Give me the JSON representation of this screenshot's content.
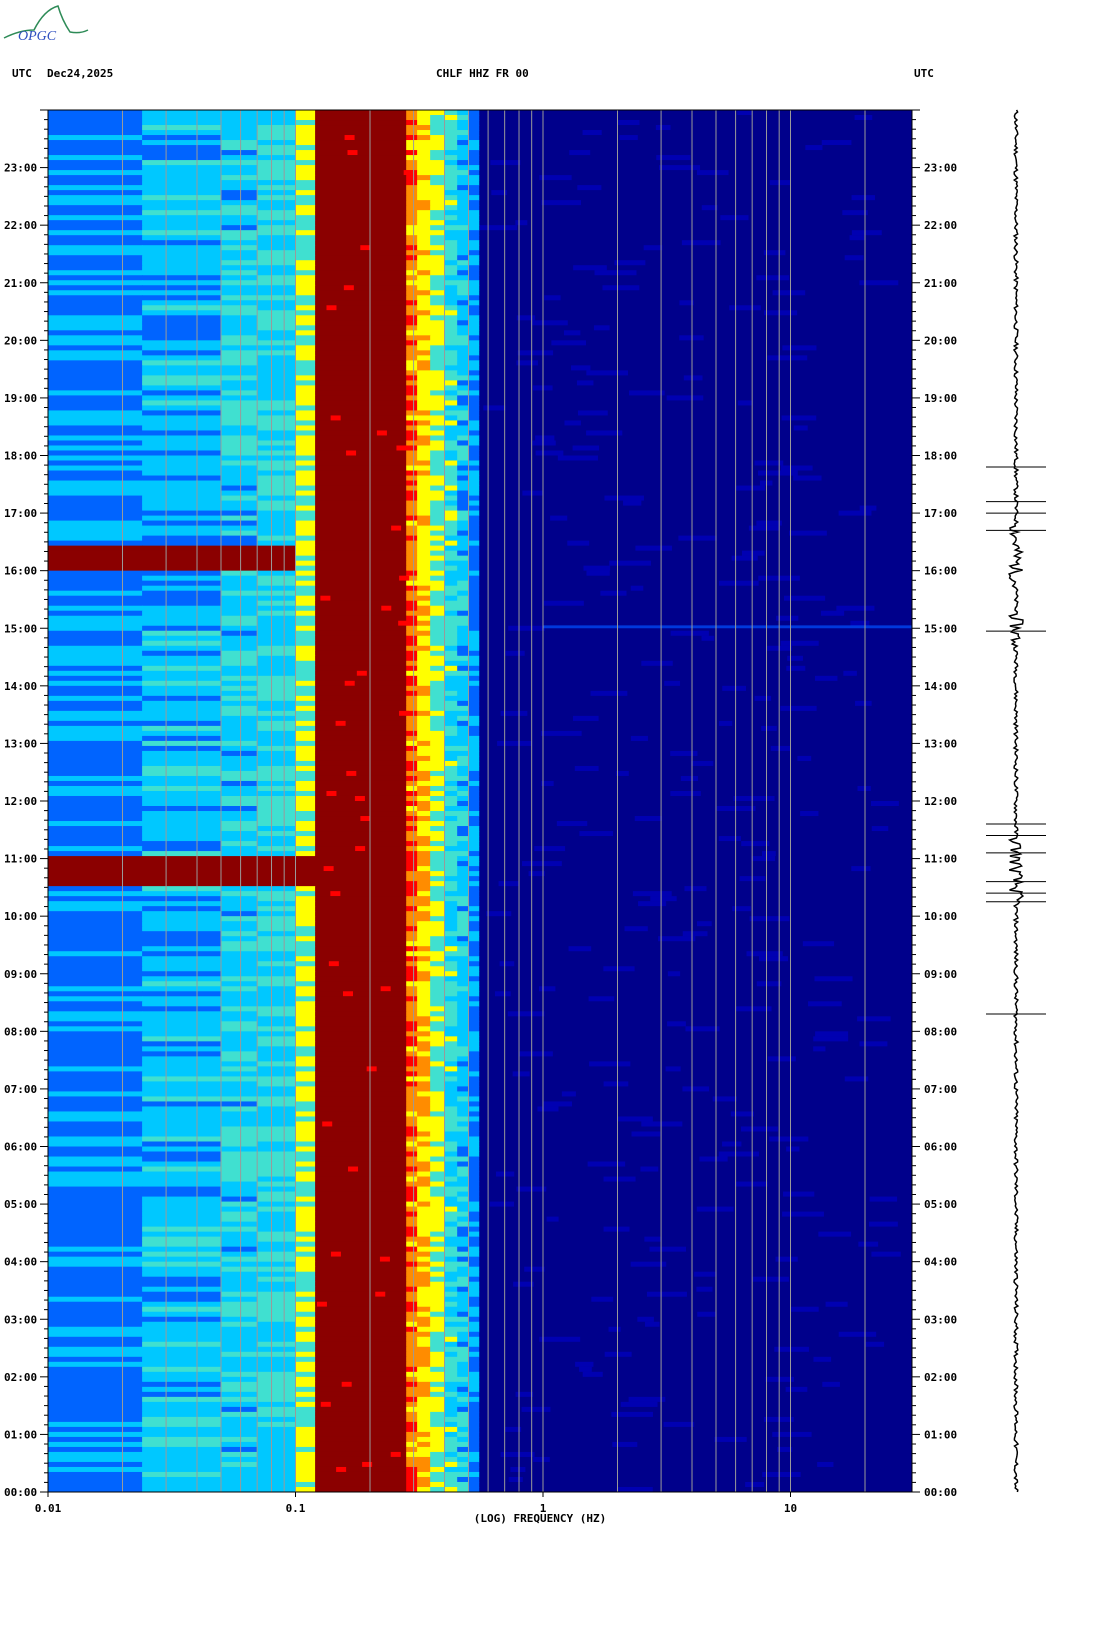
{
  "header": {
    "left_utc": "UTC",
    "date": "Dec24,2025",
    "station": "CHLF HHZ FR 00",
    "right_utc": "UTC",
    "logo_text": "OPGC"
  },
  "chart_data": {
    "type": "heatmap",
    "title": "CHLF HHZ FR 00",
    "xlabel": "(LOG) FREQUENCY (HZ)",
    "ylabel": "UTC",
    "x_scale": "log",
    "xlim": [
      0.01,
      30
    ],
    "ylim_hours": [
      0,
      24
    ],
    "x_tick_labels": [
      "0.01",
      "0.1",
      "1",
      "10"
    ],
    "y_tick_labels": [
      "00:00",
      "01:00",
      "02:00",
      "03:00",
      "04:00",
      "05:00",
      "06:00",
      "07:00",
      "08:00",
      "09:00",
      "10:00",
      "11:00",
      "12:00",
      "13:00",
      "14:00",
      "15:00",
      "16:00",
      "17:00",
      "18:00",
      "19:00",
      "20:00",
      "21:00",
      "22:00",
      "23:00"
    ],
    "colormap": [
      "#00008b",
      "#0000cd",
      "#0064ff",
      "#00c8ff",
      "#40e0d0",
      "#ffff00",
      "#ff8c00",
      "#ff0000",
      "#8b0000"
    ],
    "frequency_bands": [
      {
        "f_min": 0.01,
        "f_max": 0.12,
        "level": "low (blue-cyan)"
      },
      {
        "f_min": 0.12,
        "f_max": 0.28,
        "level": "very high (dark red)"
      },
      {
        "f_min": 0.28,
        "f_max": 0.55,
        "level": "decreasing (yellow to cyan)"
      },
      {
        "f_min": 0.55,
        "f_max": 30,
        "level": "background (dark blue)"
      }
    ],
    "events": [
      {
        "start_hour": 10.5,
        "end_hour": 11.05,
        "f_max": 0.12,
        "level": "very high"
      },
      {
        "start_hour": 16.0,
        "end_hour": 16.45,
        "f_max": 0.08,
        "level": "very high"
      },
      {
        "start_hour": 15.0,
        "end_hour": 15.05,
        "f_min": 1,
        "f_max": 30,
        "level": "weak"
      }
    ]
  }
}
